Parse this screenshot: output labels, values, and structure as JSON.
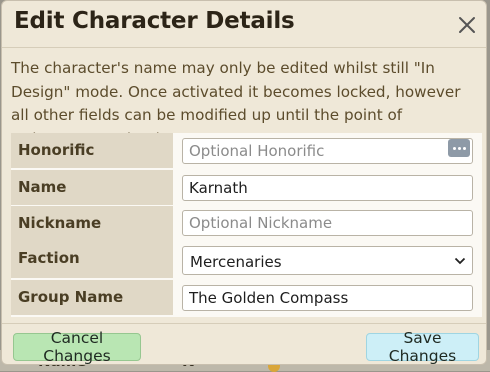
{
  "background_page": {
    "label_1": "Name",
    "label_2": "K"
  },
  "dialog": {
    "title": "Edit Character Details",
    "close_icon": "close-x-icon",
    "description": "The character's name may only be edited whilst still \"In Design\" mode. Once activated it becomes locked, however all other fields can be modified up until the point of retirement, or death."
  },
  "form": {
    "fields": [
      {
        "label": "Honorific",
        "value": "",
        "placeholder": "Optional Honorific",
        "has_picker": true
      },
      {
        "label": "Name",
        "value": "Karnath",
        "placeholder": ""
      },
      {
        "label": "Nickname",
        "value": "",
        "placeholder": "Optional Nickname"
      },
      {
        "label": "Faction",
        "value": "Mercenaries",
        "type": "select"
      },
      {
        "label": "Group Name",
        "value": "The Golden Compass",
        "placeholder": ""
      }
    ]
  },
  "footer": {
    "cancel_label": "Cancel Changes",
    "save_label": "Save Changes"
  },
  "colors": {
    "cancel_button": "#b9e6b3",
    "save_button": "#cdeff7",
    "label_cell": "#e0d8c6",
    "dialog_bg": "#efe8d8"
  }
}
